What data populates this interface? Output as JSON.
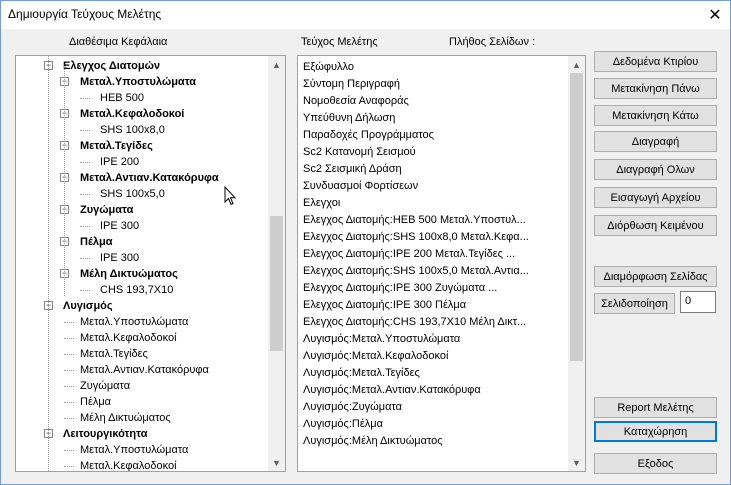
{
  "window": {
    "title": "Δημιουργία Τεύχους Μελέτης",
    "close_glyph": "✕"
  },
  "tree_header": "Διαθέσιμα Κεφάλαια",
  "list_header": "Τεύχος Μελέτης",
  "pages_header": "Πλήθος Σελίδων :",
  "tree_items": [
    {
      "text": "Ελεγχος Διατομών",
      "bold": true,
      "level": 1,
      "expander": "−"
    },
    {
      "text": "Μεταλ.Υποστυλώματα",
      "bold": true,
      "level": 2,
      "expander": "−"
    },
    {
      "text": "HEB 500",
      "bold": false,
      "level": 3
    },
    {
      "text": "Μεταλ.Κεφαλοδοκοί",
      "bold": true,
      "level": 2,
      "expander": "−"
    },
    {
      "text": "SHS 100x8,0",
      "bold": false,
      "level": 3
    },
    {
      "text": "Μεταλ.Τεγίδες",
      "bold": true,
      "level": 2,
      "expander": "−"
    },
    {
      "text": "IPE 200",
      "bold": false,
      "level": 3
    },
    {
      "text": "Μεταλ.Αντιαν.Κατακόρυφα",
      "bold": true,
      "level": 2,
      "expander": "−"
    },
    {
      "text": "SHS 100x5,0",
      "bold": false,
      "level": 3
    },
    {
      "text": "Ζυγώματα",
      "bold": true,
      "level": 2,
      "expander": "−"
    },
    {
      "text": "IPE 300",
      "bold": false,
      "level": 3
    },
    {
      "text": "Πέλμα",
      "bold": true,
      "level": 2,
      "expander": "−"
    },
    {
      "text": "IPE 300",
      "bold": false,
      "level": 3
    },
    {
      "text": "Μέλη Δικτυώματος",
      "bold": true,
      "level": 2,
      "expander": "−"
    },
    {
      "text": "CHS 193,7X10",
      "bold": false,
      "level": 3
    },
    {
      "text": "Λυγισμός",
      "bold": true,
      "level": 1,
      "expander": "−"
    },
    {
      "text": "Μεταλ.Υποστυλώματα",
      "bold": false,
      "level": 2
    },
    {
      "text": "Μεταλ.Κεφαλοδοκοί",
      "bold": false,
      "level": 2
    },
    {
      "text": "Μεταλ.Τεγίδες",
      "bold": false,
      "level": 2
    },
    {
      "text": "Μεταλ.Αντιαν.Κατακόρυφα",
      "bold": false,
      "level": 2
    },
    {
      "text": "Ζυγώματα",
      "bold": false,
      "level": 2
    },
    {
      "text": "Πέλμα",
      "bold": false,
      "level": 2
    },
    {
      "text": "Μέλη Δικτυώματος",
      "bold": false,
      "level": 2
    },
    {
      "text": "Λειτουργικότητα",
      "bold": true,
      "level": 1,
      "expander": "−"
    },
    {
      "text": "Μεταλ.Υποστυλώματα",
      "bold": false,
      "level": 2
    },
    {
      "text": "Μεταλ.Κεφαλοδοκοί",
      "bold": false,
      "level": 2
    }
  ],
  "list_items": [
    "Εξώφυλλο",
    "Σύντομη Περιγραφή",
    "Νομοθεσία Αναφοράς",
    "Υπεύθυνη Δήλωση",
    "Παραδοχές Προγράμματος",
    "Sc2 Κατανομή Σεισμού",
    "Sc2 Σεισμική Δράση",
    "Συνδυασμοί Φορτίσεων",
    "Ελεγχοι",
    "Ελεγχος Διατομής:HEB 500 Μεταλ.Υποστυλ...",
    "Ελεγχος Διατομής:SHS 100x8,0 Μεταλ.Κεφα...",
    "Ελεγχος Διατομής:IPE 200 Μεταλ.Τεγίδες ...",
    "Ελεγχος Διατομής:SHS 100x5,0 Μεταλ.Αντια...",
    "Ελεγχος Διατομής:IPE 300 Ζυγώματα ...",
    "Ελεγχος Διατομής:IPE 300 Πέλμα",
    "Ελεγχος Διατομής:CHS 193,7X10 Μέλη Δικτ...",
    "Λυγισμός:Μεταλ.Υποστυλώματα",
    "Λυγισμός:Μεταλ.Κεφαλοδοκοί",
    "Λυγισμός:Μεταλ.Τεγίδες",
    "Λυγισμός:Μεταλ.Αντιαν.Κατακόρυφα",
    "Λυγισμός:Ζυγώματα",
    "Λυγισμός:Πέλμα",
    "Λυγισμός:Μέλη Δικτυώματος"
  ],
  "buttons": {
    "building_data": "Δεδομένα Κτιρίου",
    "move_up": "Μετακίνηση Πάνω",
    "move_down": "Μετακίνηση Κάτω",
    "delete": "Διαγραφή",
    "delete_all": "Διαγραφή Ολων",
    "insert_file": "Εισαγωγή Αρχείου",
    "edit_text": "Διόρθωση Κειμένου",
    "page_setup": "Διαμόρφωση Σελίδας",
    "pagination": "Σελιδοποίηση",
    "report": "Report Μελέτης",
    "register": "Καταχώρηση",
    "exit": "Εξοδος"
  },
  "pagination_value": "0",
  "scroll_arrows": {
    "up": "▲",
    "down": "▼"
  },
  "icons": {
    "close": "close-icon",
    "scroll_up": "arrow-up-icon",
    "scroll_down": "arrow-down-icon",
    "cursor": "mouse-cursor-icon"
  }
}
